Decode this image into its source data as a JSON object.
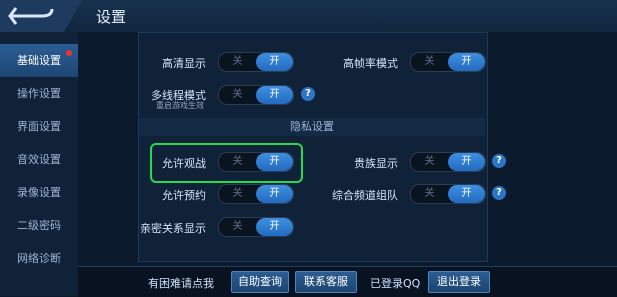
{
  "header": {
    "title": "设置"
  },
  "sidebar": {
    "items": [
      {
        "label": "基础设置"
      },
      {
        "label": "操作设置"
      },
      {
        "label": "界面设置"
      },
      {
        "label": "音效设置"
      },
      {
        "label": "录像设置"
      },
      {
        "label": "二级密码"
      },
      {
        "label": "网络诊断"
      }
    ]
  },
  "toggle": {
    "off": "关",
    "on": "开"
  },
  "settings": {
    "hd": {
      "label": "高清显示",
      "state": "开"
    },
    "high_fps": {
      "label": "高帧率模式",
      "state": "开"
    },
    "multithread": {
      "label": "多线程模式",
      "sub": "重启游戏生效",
      "state": "开"
    },
    "privacy_header": "隐私设置",
    "allow_spectate": {
      "label": "允许观战",
      "state": "开"
    },
    "noble_display": {
      "label": "贵族显示",
      "state": "开"
    },
    "allow_reserve": {
      "label": "允许预约",
      "state": "开"
    },
    "team_channel": {
      "label": "综合频道组队",
      "state": "开"
    },
    "intimacy": {
      "label": "亲密关系显示",
      "state": "开"
    }
  },
  "bottom": {
    "help_text": "有困难请点我",
    "self_query": "自助查询",
    "contact_service": "联系客服",
    "logged_in": "已登录QQ",
    "logout": "退出登录"
  },
  "colors": {
    "accent": "#2d74c7",
    "highlight": "#27d94f"
  }
}
